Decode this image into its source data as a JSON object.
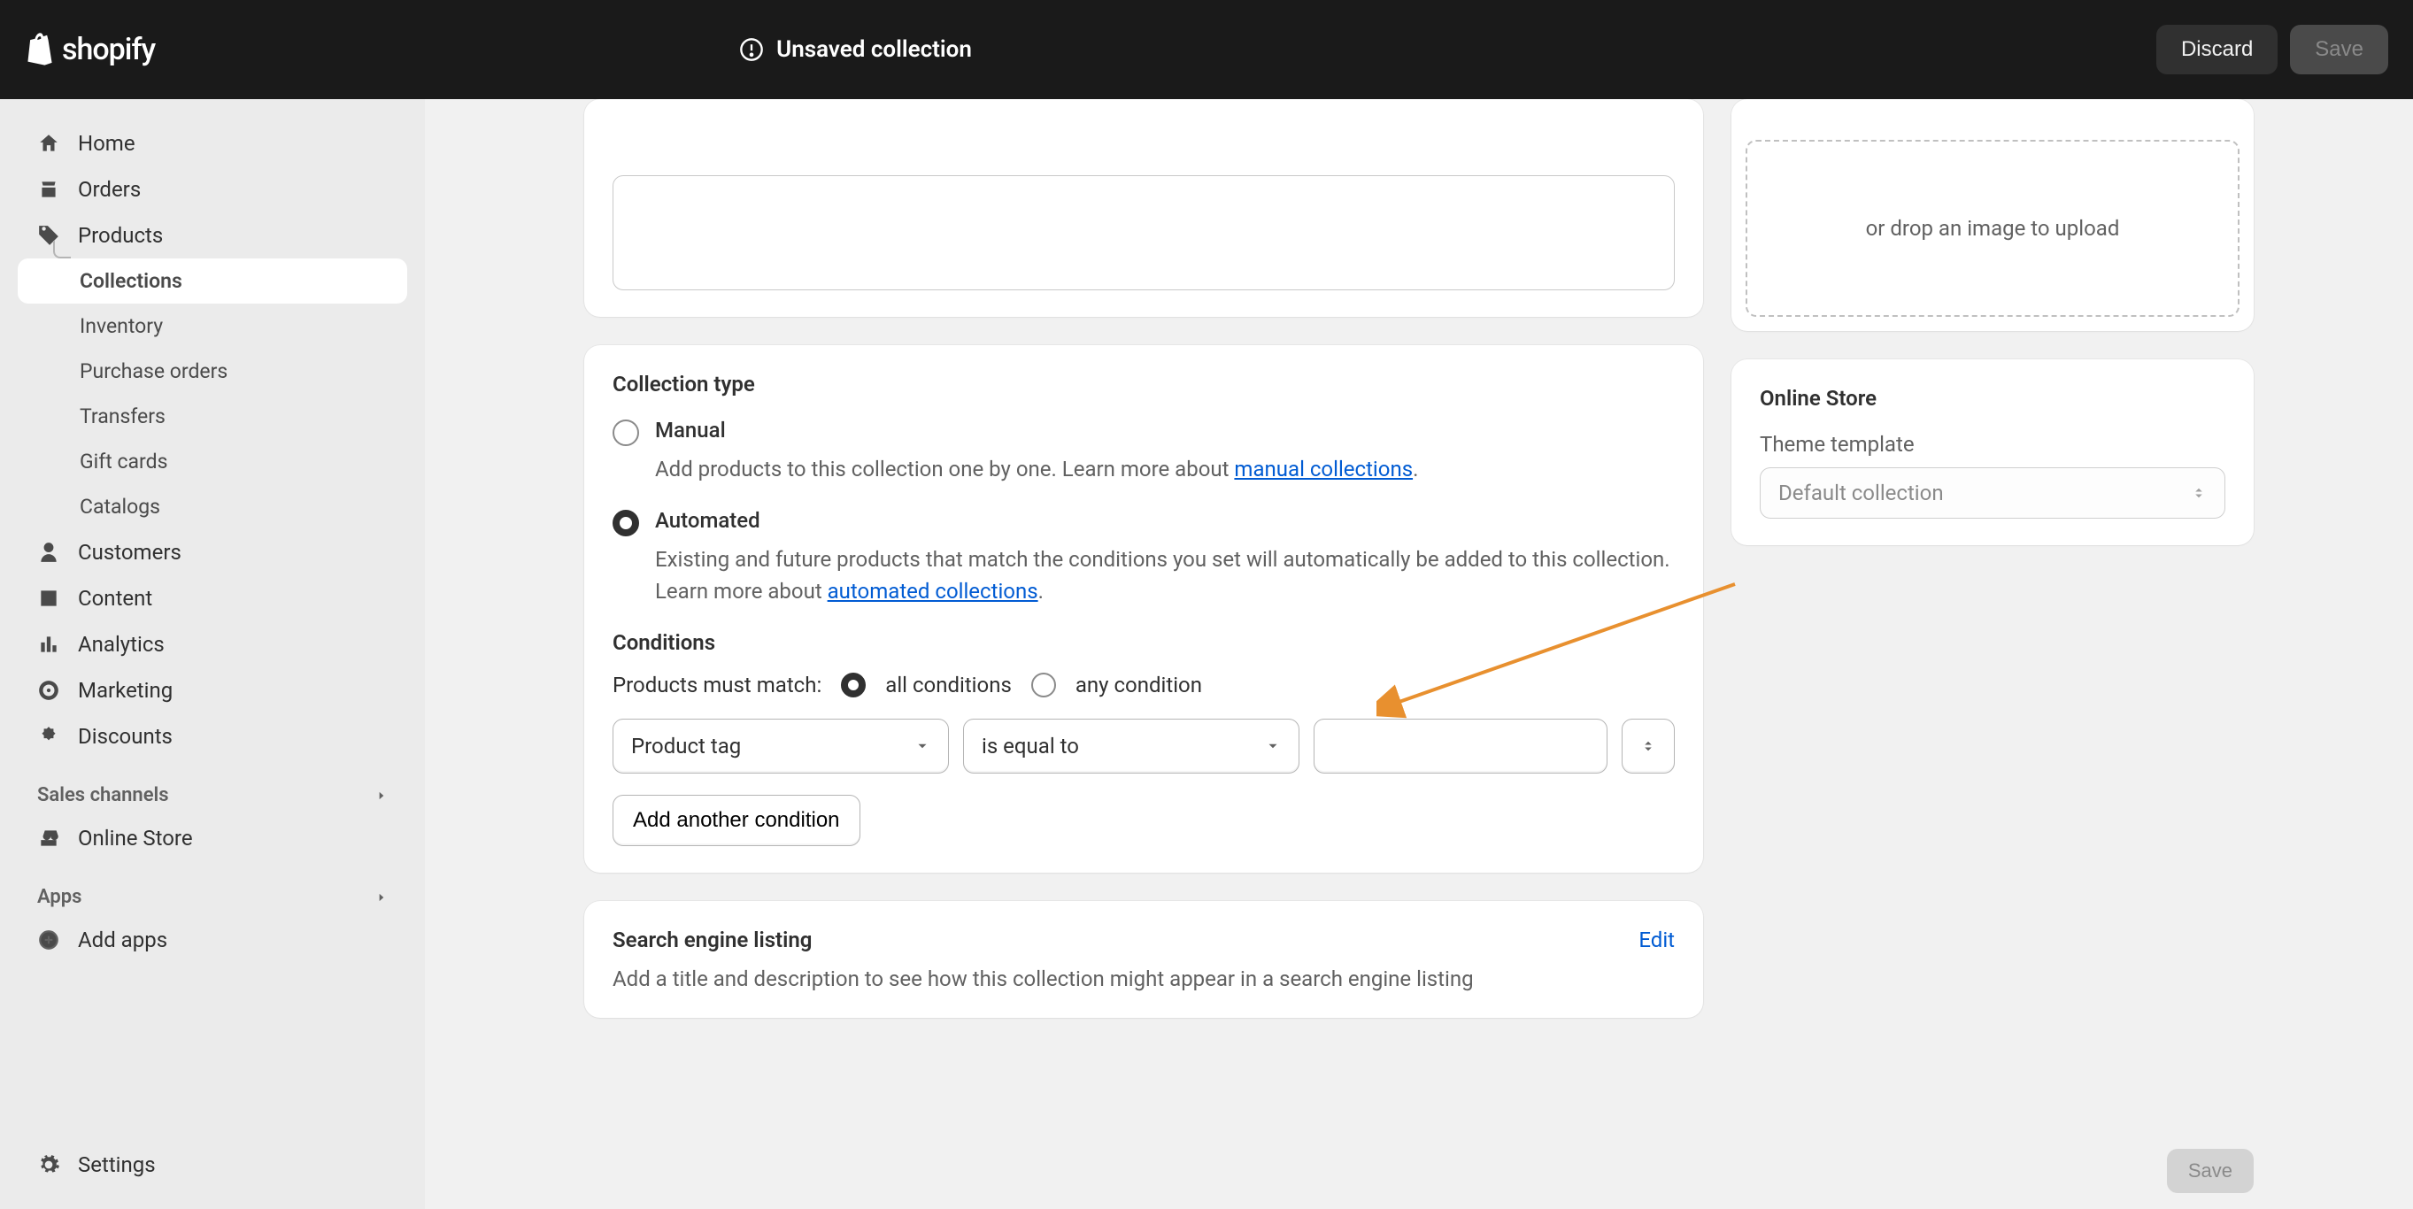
{
  "topbar": {
    "brand": "shopify",
    "title": "Unsaved collection",
    "discard": "Discard",
    "save": "Save"
  },
  "sidebar": {
    "home": "Home",
    "orders": "Orders",
    "products": "Products",
    "collections": "Collections",
    "inventory": "Inventory",
    "purchase_orders": "Purchase orders",
    "transfers": "Transfers",
    "gift_cards": "Gift cards",
    "catalogs": "Catalogs",
    "customers": "Customers",
    "content": "Content",
    "analytics": "Analytics",
    "marketing": "Marketing",
    "discounts": "Discounts",
    "sales_channels": "Sales channels",
    "online_store": "Online Store",
    "apps": "Apps",
    "add_apps": "Add apps",
    "settings": "Settings"
  },
  "image_card": {
    "drop_hint": "or drop an image to upload"
  },
  "collection_type": {
    "title": "Collection type",
    "manual_label": "Manual",
    "manual_desc_pre": "Add products to this collection one by one. Learn more about ",
    "manual_desc_link": "manual collections",
    "automated_label": "Automated",
    "automated_desc_pre": "Existing and future products that match the conditions you set will automatically be added to this collection. Learn more about ",
    "automated_desc_link": "automated collections"
  },
  "conditions": {
    "title": "Conditions",
    "match_label": "Products must match:",
    "all": "all conditions",
    "any": "any condition",
    "field": "Product tag",
    "operator": "is equal to",
    "value": "",
    "add_another": "Add another condition"
  },
  "seo": {
    "title": "Search engine listing",
    "edit": "Edit",
    "desc": "Add a title and description to see how this collection might appear in a search engine listing"
  },
  "online_store": {
    "title": "Online Store",
    "theme_label": "Theme template",
    "theme_value": "Default collection"
  },
  "footer": {
    "save": "Save"
  }
}
